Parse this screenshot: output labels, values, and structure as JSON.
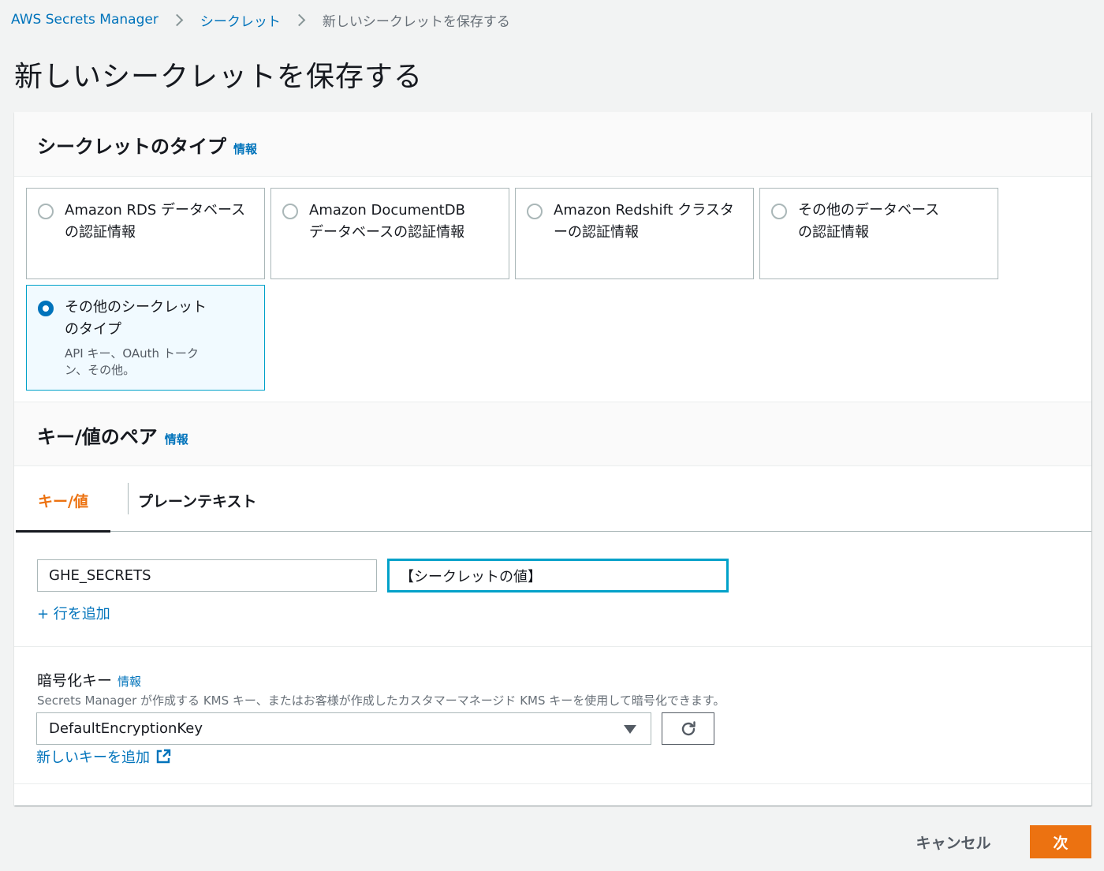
{
  "breadcrumb": {
    "items": [
      "AWS Secrets Manager",
      "シークレット",
      "新しいシークレットを保存する"
    ]
  },
  "page_title": "新しいシークレットを保存する",
  "secret_type": {
    "heading": "シークレットのタイプ",
    "info": "情報",
    "options": [
      {
        "label": "Amazon RDS データベースの認証情報",
        "selected": false
      },
      {
        "label": "Amazon DocumentDB データベースの認証情報",
        "selected": false
      },
      {
        "label": "Amazon Redshift クラスターの認証情報",
        "selected": false
      },
      {
        "label": "その他のデータベースの認証情報",
        "selected": false
      },
      {
        "label": "その他のシークレットのタイプ",
        "description": "API キー、OAuth トークン、その他。",
        "selected": true
      }
    ]
  },
  "kv_pair": {
    "heading": "キー/値のペア",
    "info": "情報",
    "tabs": [
      {
        "label": "キー/値",
        "active": true
      },
      {
        "label": "プレーンテキスト",
        "active": false
      }
    ],
    "key_value": "GHE_SECRETS",
    "value_value": "【シークレットの値】",
    "add_row": "+ 行を追加"
  },
  "encryption": {
    "label": "暗号化キー",
    "info": "情報",
    "description": "Secrets Manager が作成する KMS キー、またはお客様が作成したカスタマーマネージド KMS キーを使用して暗号化できます。",
    "selected_key": "DefaultEncryptionKey",
    "add_new_key": "新しいキーを追加"
  },
  "footer": {
    "cancel": "キャンセル",
    "next": "次"
  },
  "colors": {
    "accent": "#ec7211",
    "link": "#0073bb",
    "selected_border": "#00a1c9"
  }
}
